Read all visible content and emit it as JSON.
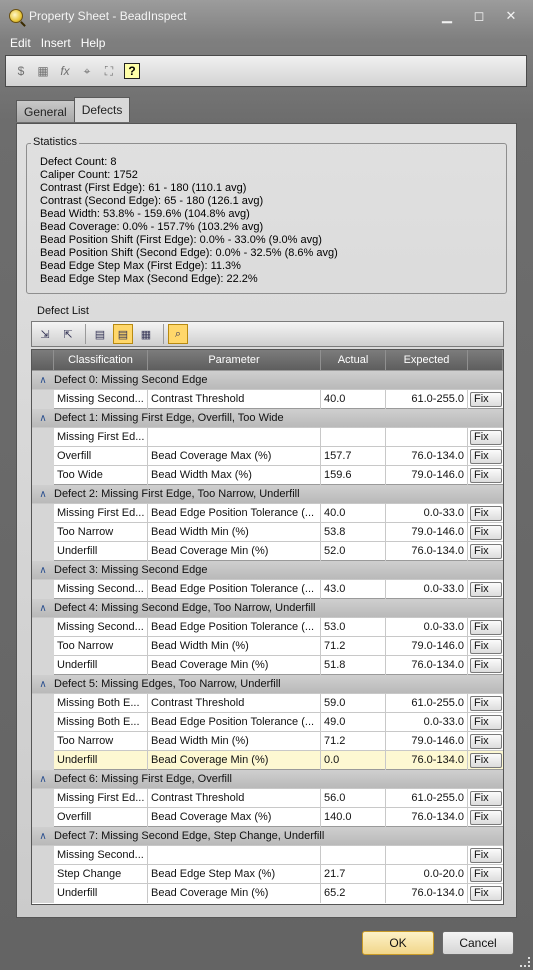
{
  "window": {
    "title": "Property Sheet - BeadInspect",
    "minimize": "▁",
    "maximize": "◻",
    "close": "✕"
  },
  "menu": [
    "Edit",
    "Insert",
    "Help"
  ],
  "toolbar": {
    "help_label": "?"
  },
  "tabs": [
    {
      "label": "General",
      "active": false
    },
    {
      "label": "Defects",
      "active": true
    }
  ],
  "statistics": {
    "legend": "Statistics",
    "lines": [
      "Defect Count: 8",
      "Caliper Count: 1752",
      "Contrast (First Edge): 61 - 180 (110.1 avg)",
      "Contrast (Second Edge): 65 - 180 (126.1 avg)",
      "Bead Width: 53.8% - 159.6% (104.8% avg)",
      "Bead Coverage: 0.0% - 157.7% (103.2% avg)",
      "Bead Position Shift (First Edge): 0.0% - 33.0% (9.0% avg)",
      "Bead Position Shift (Second Edge): 0.0% - 32.5% (8.6% avg)",
      "Bead Edge Step Max (First Edge): 11.3%",
      "Bead Edge Step Max (Second Edge): 22.2%"
    ]
  },
  "defect_list": {
    "label": "Defect List",
    "columns": {
      "classification": "Classification",
      "parameter": "Parameter",
      "actual": "Actual",
      "expected": "Expected"
    },
    "fix_label": "Fix",
    "groups": [
      {
        "title": "Defect  0: Missing Second Edge",
        "rows": [
          {
            "cls": "Missing Second...",
            "par": "Contrast Threshold",
            "act": "40.0",
            "exp": "61.0-255.0"
          }
        ]
      },
      {
        "title": "Defect  1: Missing First Edge, Overfill, Too Wide",
        "rows": [
          {
            "cls": "Missing First Ed...",
            "par": "",
            "act": "",
            "exp": ""
          },
          {
            "cls": "Overfill",
            "par": "Bead Coverage Max (%)",
            "act": "157.7",
            "exp": "76.0-134.0"
          },
          {
            "cls": "Too Wide",
            "par": "Bead Width Max (%)",
            "act": "159.6",
            "exp": "79.0-146.0"
          }
        ]
      },
      {
        "title": "Defect  2: Missing First Edge, Too Narrow, Underfill",
        "rows": [
          {
            "cls": "Missing First Ed...",
            "par": "Bead Edge Position Tolerance (...",
            "act": "40.0",
            "exp": "0.0-33.0"
          },
          {
            "cls": "Too Narrow",
            "par": "Bead Width Min (%)",
            "act": "53.8",
            "exp": "79.0-146.0"
          },
          {
            "cls": "Underfill",
            "par": "Bead Coverage Min (%)",
            "act": "52.0",
            "exp": "76.0-134.0"
          }
        ]
      },
      {
        "title": "Defect  3: Missing Second Edge",
        "rows": [
          {
            "cls": "Missing Second...",
            "par": "Bead Edge Position Tolerance (...",
            "act": "43.0",
            "exp": "0.0-33.0"
          }
        ]
      },
      {
        "title": "Defect  4: Missing Second Edge, Too Narrow, Underfill",
        "rows": [
          {
            "cls": "Missing Second...",
            "par": "Bead Edge Position Tolerance (...",
            "act": "53.0",
            "exp": "0.0-33.0"
          },
          {
            "cls": "Too Narrow",
            "par": "Bead Width Min (%)",
            "act": "71.2",
            "exp": "79.0-146.0"
          },
          {
            "cls": "Underfill",
            "par": "Bead Coverage Min (%)",
            "act": "51.8",
            "exp": "76.0-134.0"
          }
        ]
      },
      {
        "title": "Defect  5: Missing Edges, Too Narrow, Underfill",
        "rows": [
          {
            "cls": "Missing Both E...",
            "par": "Contrast Threshold",
            "act": "59.0",
            "exp": "61.0-255.0"
          },
          {
            "cls": "Missing Both E...",
            "par": "Bead Edge Position Tolerance (...",
            "act": "49.0",
            "exp": "0.0-33.0"
          },
          {
            "cls": "Too Narrow",
            "par": "Bead Width Min (%)",
            "act": "71.2",
            "exp": "79.0-146.0"
          },
          {
            "cls": "Underfill",
            "par": "Bead Coverage Min (%)",
            "act": "0.0",
            "exp": "76.0-134.0",
            "highlight": true
          }
        ]
      },
      {
        "title": "Defect  6: Missing First Edge, Overfill",
        "rows": [
          {
            "cls": "Missing First Ed...",
            "par": "Contrast Threshold",
            "act": "56.0",
            "exp": "61.0-255.0"
          },
          {
            "cls": "Overfill",
            "par": "Bead Coverage Max (%)",
            "act": "140.0",
            "exp": "76.0-134.0"
          }
        ]
      },
      {
        "title": "Defect  7: Missing Second Edge, Step Change, Underfill",
        "rows": [
          {
            "cls": "Missing Second...",
            "par": "",
            "act": "",
            "exp": ""
          },
          {
            "cls": "Step Change",
            "par": "Bead Edge Step Max (%)",
            "act": "21.7",
            "exp": "0.0-20.0"
          },
          {
            "cls": "Underfill",
            "par": "Bead Coverage Min (%)",
            "act": "65.2",
            "exp": "76.0-134.0"
          }
        ]
      }
    ]
  },
  "buttons": {
    "ok": "OK",
    "cancel": "Cancel"
  }
}
